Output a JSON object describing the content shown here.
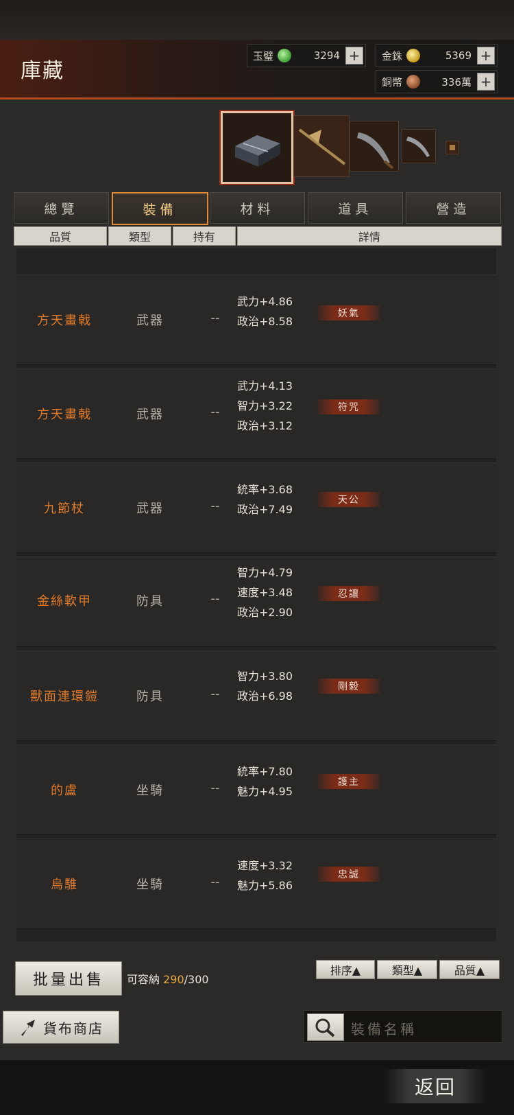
{
  "header": {
    "title": "庫藏"
  },
  "currencies": [
    {
      "name": "玉璧",
      "amount": "3294",
      "icon": "jade-coin-icon"
    },
    {
      "name": "金銖",
      "amount": "5369",
      "icon": "gold-coin-icon"
    },
    {
      "name": "銅幣",
      "amount": "336萬",
      "icon": "copper-coin-icon"
    }
  ],
  "tabs": [
    "總覽",
    "裝備",
    "材料",
    "道具",
    "營造"
  ],
  "active_tab": "裝備",
  "columns": {
    "quality": "品質",
    "type": "類型",
    "holder": "持有",
    "details": "詳情"
  },
  "items": [
    {
      "name": "方天畫戟",
      "type": "武器",
      "holder": "--",
      "stats": [
        "武力+4.86",
        "政治+8.58"
      ],
      "tag": "妖氣"
    },
    {
      "name": "方天畫戟",
      "type": "武器",
      "holder": "--",
      "stats": [
        "武力+4.13",
        "智力+3.22",
        "政治+3.12"
      ],
      "tag": "符咒"
    },
    {
      "name": "九節杖",
      "type": "武器",
      "holder": "--",
      "stats": [
        "統率+3.68",
        "政治+7.49"
      ],
      "tag": "天公"
    },
    {
      "name": "金絲軟甲",
      "type": "防具",
      "holder": "--",
      "stats": [
        "智力+4.79",
        "速度+3.48",
        "政治+2.90"
      ],
      "tag": "忍讓"
    },
    {
      "name": "獸面連環鎧",
      "type": "防具",
      "holder": "--",
      "stats": [
        "智力+3.80",
        "政治+6.98"
      ],
      "tag": "剛毅"
    },
    {
      "name": "的盧",
      "type": "坐騎",
      "holder": "--",
      "stats": [
        "統率+7.80",
        "魅力+4.95"
      ],
      "tag": "護主"
    },
    {
      "name": "烏騅",
      "type": "坐騎",
      "holder": "--",
      "stats": [
        "速度+3.32",
        "魅力+5.86"
      ],
      "tag": "忠誠"
    }
  ],
  "footer": {
    "batch_sell": "批量出售",
    "capacity_label": "可容納",
    "capacity_used": "290",
    "capacity_total": "/300",
    "sort_buttons": [
      "排序▲",
      "類型▲",
      "品質▲"
    ],
    "shop_button": "貨布商店",
    "search_placeholder": "裝備名稱",
    "back_button": "返回"
  },
  "colors": {
    "accent": "#e08a3c",
    "item_name": "#e07a2a",
    "tag_bg": "#7a2c18"
  }
}
